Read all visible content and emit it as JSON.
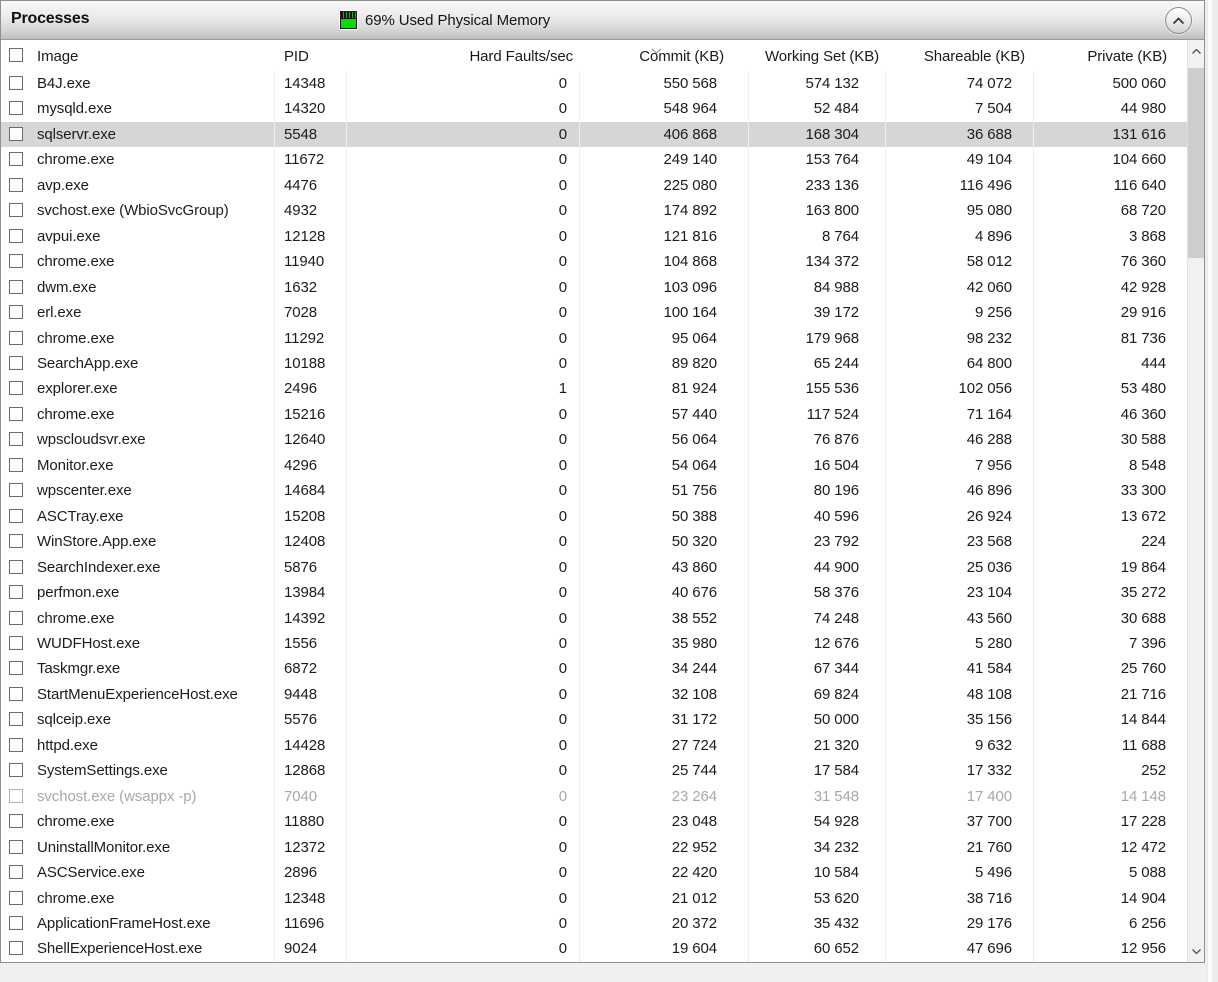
{
  "panel": {
    "title": "Processes",
    "memory_status": "69% Used Physical Memory",
    "memory_used_percent": 69
  },
  "icons": {
    "memory": "memory-chip-icon",
    "collapse": "chevron-up-icon",
    "sort": "chevron-down-icon"
  },
  "colors": {
    "memory_green": "#00e103",
    "selected_row": "#d6d6d6",
    "disabled_text": "#a8a8a8",
    "column_separator": "#e9eff6",
    "header_gradient_bottom": "#bfbfbf"
  },
  "table": {
    "select_all_checked": false,
    "sorted_column": "commit",
    "sort_direction": "desc",
    "columns": [
      {
        "key": "image",
        "label": "Image"
      },
      {
        "key": "pid",
        "label": "PID"
      },
      {
        "key": "hard_faults",
        "label": "Hard Faults/sec"
      },
      {
        "key": "commit",
        "label": "Commit (KB)"
      },
      {
        "key": "working_set",
        "label": "Working Set (KB)"
      },
      {
        "key": "shareable",
        "label": "Shareable (KB)"
      },
      {
        "key": "private",
        "label": "Private (KB)"
      }
    ],
    "rows": [
      {
        "image": "B4J.exe",
        "pid": "14348",
        "hard_faults": "0",
        "commit": "550 568",
        "working_set": "574 132",
        "shareable": "74 072",
        "private": "500 060",
        "state": "normal"
      },
      {
        "image": "mysqld.exe",
        "pid": "14320",
        "hard_faults": "0",
        "commit": "548 964",
        "working_set": "52 484",
        "shareable": "7 504",
        "private": "44 980",
        "state": "normal"
      },
      {
        "image": "sqlservr.exe",
        "pid": "5548",
        "hard_faults": "0",
        "commit": "406 868",
        "working_set": "168 304",
        "shareable": "36 688",
        "private": "131 616",
        "state": "selected"
      },
      {
        "image": "chrome.exe",
        "pid": "11672",
        "hard_faults": "0",
        "commit": "249 140",
        "working_set": "153 764",
        "shareable": "49 104",
        "private": "104 660",
        "state": "normal"
      },
      {
        "image": "avp.exe",
        "pid": "4476",
        "hard_faults": "0",
        "commit": "225 080",
        "working_set": "233 136",
        "shareable": "116 496",
        "private": "116 640",
        "state": "normal"
      },
      {
        "image": "svchost.exe (WbioSvcGroup)",
        "pid": "4932",
        "hard_faults": "0",
        "commit": "174 892",
        "working_set": "163 800",
        "shareable": "95 080",
        "private": "68 720",
        "state": "normal"
      },
      {
        "image": "avpui.exe",
        "pid": "12128",
        "hard_faults": "0",
        "commit": "121 816",
        "working_set": "8 764",
        "shareable": "4 896",
        "private": "3 868",
        "state": "normal"
      },
      {
        "image": "chrome.exe",
        "pid": "11940",
        "hard_faults": "0",
        "commit": "104 868",
        "working_set": "134 372",
        "shareable": "58 012",
        "private": "76 360",
        "state": "normal"
      },
      {
        "image": "dwm.exe",
        "pid": "1632",
        "hard_faults": "0",
        "commit": "103 096",
        "working_set": "84 988",
        "shareable": "42 060",
        "private": "42 928",
        "state": "normal"
      },
      {
        "image": "erl.exe",
        "pid": "7028",
        "hard_faults": "0",
        "commit": "100 164",
        "working_set": "39 172",
        "shareable": "9 256",
        "private": "29 916",
        "state": "normal"
      },
      {
        "image": "chrome.exe",
        "pid": "11292",
        "hard_faults": "0",
        "commit": "95 064",
        "working_set": "179 968",
        "shareable": "98 232",
        "private": "81 736",
        "state": "normal"
      },
      {
        "image": "SearchApp.exe",
        "pid": "10188",
        "hard_faults": "0",
        "commit": "89 820",
        "working_set": "65 244",
        "shareable": "64 800",
        "private": "444",
        "state": "normal"
      },
      {
        "image": "explorer.exe",
        "pid": "2496",
        "hard_faults": "1",
        "commit": "81 924",
        "working_set": "155 536",
        "shareable": "102 056",
        "private": "53 480",
        "state": "normal"
      },
      {
        "image": "chrome.exe",
        "pid": "15216",
        "hard_faults": "0",
        "commit": "57 440",
        "working_set": "117 524",
        "shareable": "71 164",
        "private": "46 360",
        "state": "normal"
      },
      {
        "image": "wpscloudsvr.exe",
        "pid": "12640",
        "hard_faults": "0",
        "commit": "56 064",
        "working_set": "76 876",
        "shareable": "46 288",
        "private": "30 588",
        "state": "normal"
      },
      {
        "image": "Monitor.exe",
        "pid": "4296",
        "hard_faults": "0",
        "commit": "54 064",
        "working_set": "16 504",
        "shareable": "7 956",
        "private": "8 548",
        "state": "normal"
      },
      {
        "image": "wpscenter.exe",
        "pid": "14684",
        "hard_faults": "0",
        "commit": "51 756",
        "working_set": "80 196",
        "shareable": "46 896",
        "private": "33 300",
        "state": "normal"
      },
      {
        "image": "ASCTray.exe",
        "pid": "15208",
        "hard_faults": "0",
        "commit": "50 388",
        "working_set": "40 596",
        "shareable": "26 924",
        "private": "13 672",
        "state": "normal"
      },
      {
        "image": "WinStore.App.exe",
        "pid": "12408",
        "hard_faults": "0",
        "commit": "50 320",
        "working_set": "23 792",
        "shareable": "23 568",
        "private": "224",
        "state": "normal"
      },
      {
        "image": "SearchIndexer.exe",
        "pid": "5876",
        "hard_faults": "0",
        "commit": "43 860",
        "working_set": "44 900",
        "shareable": "25 036",
        "private": "19 864",
        "state": "normal"
      },
      {
        "image": "perfmon.exe",
        "pid": "13984",
        "hard_faults": "0",
        "commit": "40 676",
        "working_set": "58 376",
        "shareable": "23 104",
        "private": "35 272",
        "state": "normal"
      },
      {
        "image": "chrome.exe",
        "pid": "14392",
        "hard_faults": "0",
        "commit": "38 552",
        "working_set": "74 248",
        "shareable": "43 560",
        "private": "30 688",
        "state": "normal"
      },
      {
        "image": "WUDFHost.exe",
        "pid": "1556",
        "hard_faults": "0",
        "commit": "35 980",
        "working_set": "12 676",
        "shareable": "5 280",
        "private": "7 396",
        "state": "normal"
      },
      {
        "image": "Taskmgr.exe",
        "pid": "6872",
        "hard_faults": "0",
        "commit": "34 244",
        "working_set": "67 344",
        "shareable": "41 584",
        "private": "25 760",
        "state": "normal"
      },
      {
        "image": "StartMenuExperienceHost.exe",
        "pid": "9448",
        "hard_faults": "0",
        "commit": "32 108",
        "working_set": "69 824",
        "shareable": "48 108",
        "private": "21 716",
        "state": "normal"
      },
      {
        "image": "sqlceip.exe",
        "pid": "5576",
        "hard_faults": "0",
        "commit": "31 172",
        "working_set": "50 000",
        "shareable": "35 156",
        "private": "14 844",
        "state": "normal"
      },
      {
        "image": "httpd.exe",
        "pid": "14428",
        "hard_faults": "0",
        "commit": "27 724",
        "working_set": "21 320",
        "shareable": "9 632",
        "private": "11 688",
        "state": "normal"
      },
      {
        "image": "SystemSettings.exe",
        "pid": "12868",
        "hard_faults": "0",
        "commit": "25 744",
        "working_set": "17 584",
        "shareable": "17 332",
        "private": "252",
        "state": "normal"
      },
      {
        "image": "svchost.exe (wsappx -p)",
        "pid": "7040",
        "hard_faults": "0",
        "commit": "23 264",
        "working_set": "31 548",
        "shareable": "17 400",
        "private": "14 148",
        "state": "disabled"
      },
      {
        "image": "chrome.exe",
        "pid": "11880",
        "hard_faults": "0",
        "commit": "23 048",
        "working_set": "54 928",
        "shareable": "37 700",
        "private": "17 228",
        "state": "normal"
      },
      {
        "image": "UninstallMonitor.exe",
        "pid": "12372",
        "hard_faults": "0",
        "commit": "22 952",
        "working_set": "34 232",
        "shareable": "21 760",
        "private": "12 472",
        "state": "normal"
      },
      {
        "image": "ASCService.exe",
        "pid": "2896",
        "hard_faults": "0",
        "commit": "22 420",
        "working_set": "10 584",
        "shareable": "5 496",
        "private": "5 088",
        "state": "normal"
      },
      {
        "image": "chrome.exe",
        "pid": "12348",
        "hard_faults": "0",
        "commit": "21 012",
        "working_set": "53 620",
        "shareable": "38 716",
        "private": "14 904",
        "state": "normal"
      },
      {
        "image": "ApplicationFrameHost.exe",
        "pid": "11696",
        "hard_faults": "0",
        "commit": "20 372",
        "working_set": "35 432",
        "shareable": "29 176",
        "private": "6 256",
        "state": "normal"
      },
      {
        "image": "ShellExperienceHost.exe",
        "pid": "9024",
        "hard_faults": "0",
        "commit": "19 604",
        "working_set": "60 652",
        "shareable": "47 696",
        "private": "12 956",
        "state": "normal"
      }
    ]
  }
}
